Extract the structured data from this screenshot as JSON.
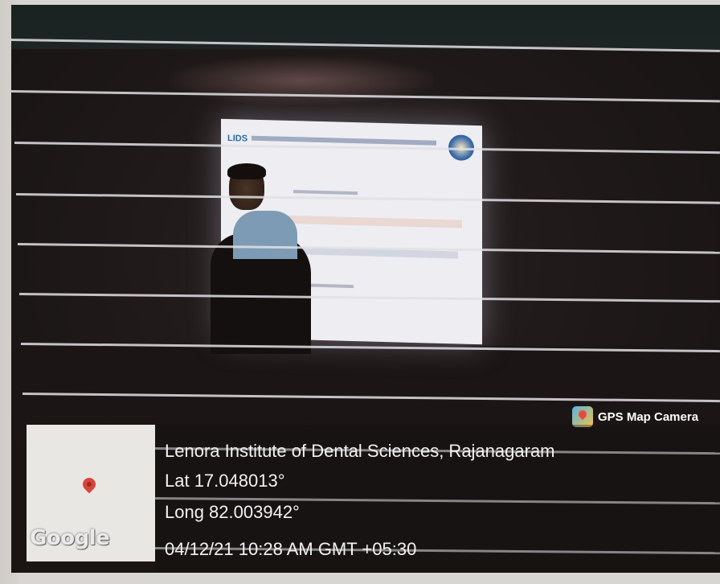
{
  "photo": {
    "screen_slide": {
      "logo_text": "LIDS"
    }
  },
  "overlay": {
    "badge_label": "GPS Map Camera",
    "badge_icon": "map-pin-icon",
    "map_logo": "Google",
    "map_icon": "location-pin-icon",
    "location": "Lenora Institute of Dental Sciences, Rajanagaram",
    "latitude": "Lat 17.048013°",
    "longitude": "Long 82.003942°",
    "datetime": "04/12/21 10:28 AM GMT +05:30"
  },
  "colors": {
    "pin": "#d9453b",
    "wall": "#1f1919",
    "stripe": "#e1e1e4"
  }
}
